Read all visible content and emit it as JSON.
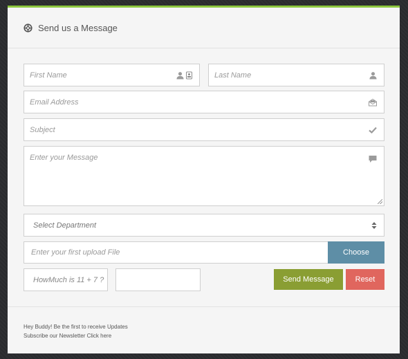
{
  "form": {
    "title": "Send us a Message",
    "first_name_placeholder": "First Name",
    "last_name_placeholder": "Last Name",
    "email_placeholder": "Email Address",
    "subject_placeholder": "Subject",
    "message_placeholder": "Enter your Message",
    "department_selected": "Select Department",
    "upload_placeholder": "Enter your first upload File",
    "choose_label": "Choose",
    "captcha_question": "HowMuch is 11 + 7 ?",
    "captcha_answer": "",
    "send_label": "Send Message",
    "reset_label": "Reset"
  },
  "footer": {
    "line1": "Hey Buddy! Be the first to receive Updates",
    "line2": "Subscribe our Newsletter Click here"
  },
  "colors": {
    "accent_top": "#8cc63e",
    "choose": "#5e8ea6",
    "send": "#8a9e33",
    "reset": "#e0665e"
  },
  "icons": {
    "header": "lifebuoy-icon",
    "first_name": [
      "user-icon",
      "id-card-icon"
    ],
    "last_name": "user-icon",
    "email": "envelope-open-icon",
    "subject": "check-icon",
    "message": "comment-icon",
    "department": "sort-arrows-icon"
  }
}
